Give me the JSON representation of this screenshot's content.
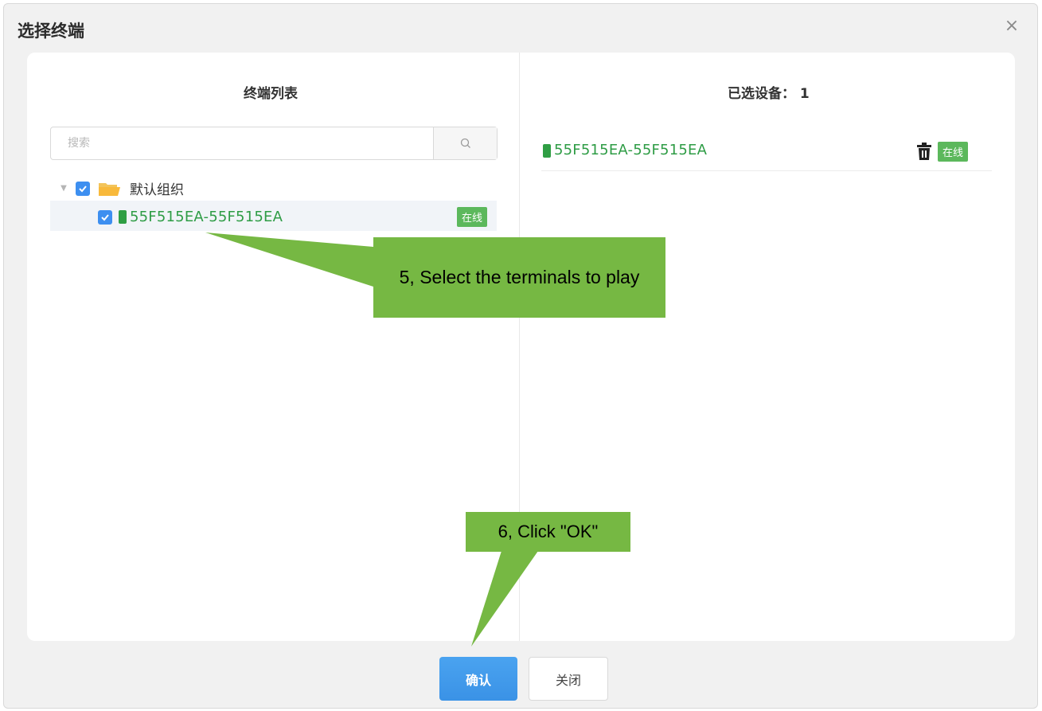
{
  "dialog": {
    "title": "选择终端",
    "close_glyph": "×"
  },
  "left": {
    "title": "终端列表",
    "search": {
      "placeholder": "搜索",
      "value": ""
    },
    "group": {
      "label": "默认组织",
      "checked": true,
      "expanded": true
    },
    "devices": [
      {
        "name": "55F515EA-55F515EA",
        "status": "在线",
        "checked": true
      }
    ]
  },
  "right": {
    "title": "已选设备：",
    "count": "1",
    "selected": [
      {
        "name": "55F515EA-55F515EA",
        "status": "在线"
      }
    ]
  },
  "annotations": {
    "step5": "5, Select the terminals to play",
    "step6": "6, Click \"OK\""
  },
  "buttons": {
    "ok": "确认",
    "close": "关闭"
  },
  "colors": {
    "annotation": "#76b843",
    "primary": "#3d8ff0",
    "online": "#5cb85c",
    "device_text": "#2e9c45"
  }
}
